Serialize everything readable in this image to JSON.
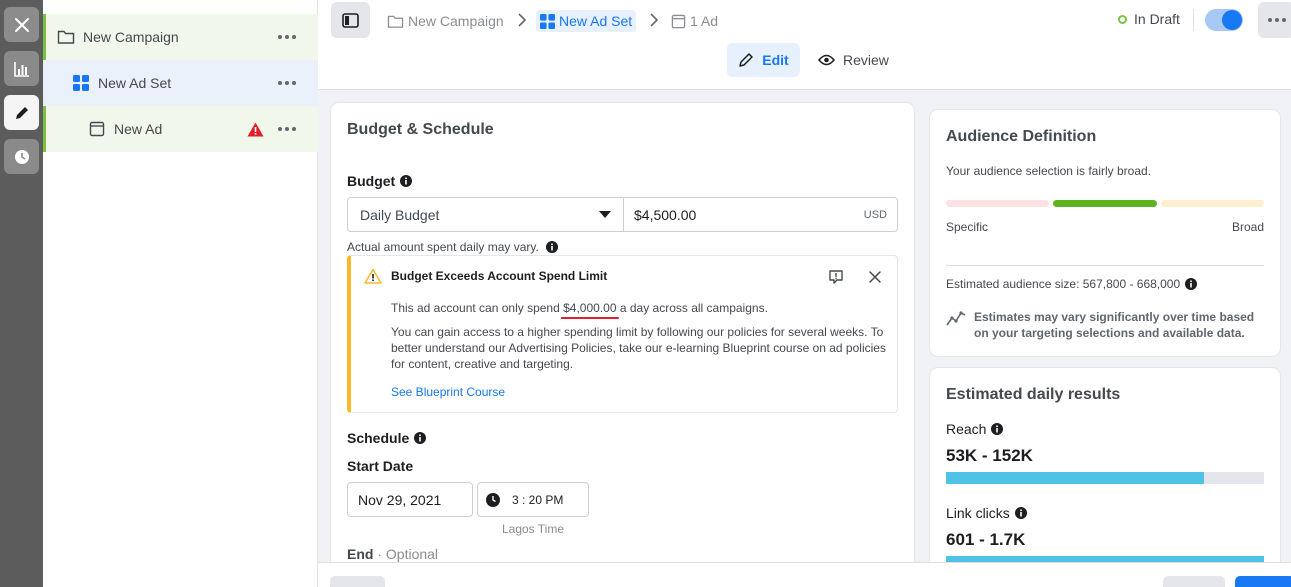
{
  "colors": {
    "accent": "#1877f2",
    "success": "#7bc043",
    "warning": "#f7b928",
    "error": "#e0202a",
    "bar": "#4ec3e6"
  },
  "rail": {
    "icons": [
      "close-icon",
      "chart-icon",
      "pencil-icon",
      "clock-icon"
    ]
  },
  "tree": {
    "campaign": "New Campaign",
    "ad_set": "New Ad Set",
    "ad": "New Ad"
  },
  "breadcrumb": {
    "campaign": "New Campaign",
    "ad_set": "New Ad Set",
    "ad": "1 Ad"
  },
  "header": {
    "status": "In Draft",
    "tab_edit": "Edit",
    "tab_review": "Review"
  },
  "budget": {
    "section_title": "Budget & Schedule",
    "label": "Budget",
    "type": "Daily Budget",
    "amount": "$4,500.00",
    "currency": "USD",
    "note": "Actual amount spent daily may vary."
  },
  "alert": {
    "title": "Budget Exceeds Account Spend Limit",
    "line1_before": "This ad account can only spend ",
    "line1_amount": "$4,000.00",
    "line1_after": " a day across all campaigns.",
    "line2": "You can gain access to a higher spending limit by following our policies for several weeks. To better understand our Advertising Policies, take our e-learning Blueprint course on ad policies for content, creative and targeting.",
    "link": "See Blueprint Course"
  },
  "schedule": {
    "label": "Schedule",
    "start_label": "Start Date",
    "start_date": "Nov 29, 2021",
    "start_time": "3 : 20 PM",
    "timezone": "Lagos Time",
    "end_label": "End",
    "end_optional": "· Optional"
  },
  "audience": {
    "title": "Audience Definition",
    "summary": "Your audience selection is fairly broad.",
    "specific": "Specific",
    "broad": "Broad",
    "size": "Estimated audience size: 567,800 - 668,000",
    "disclaimer": "Estimates may vary significantly over time based on your targeting selections and available data."
  },
  "results": {
    "title": "Estimated daily results",
    "reach_label": "Reach",
    "reach_value": "53K - 152K",
    "reach_fill": 0.81,
    "clicks_label": "Link clicks",
    "clicks_value": "601 - 1.7K",
    "clicks_fill": 1.0
  }
}
